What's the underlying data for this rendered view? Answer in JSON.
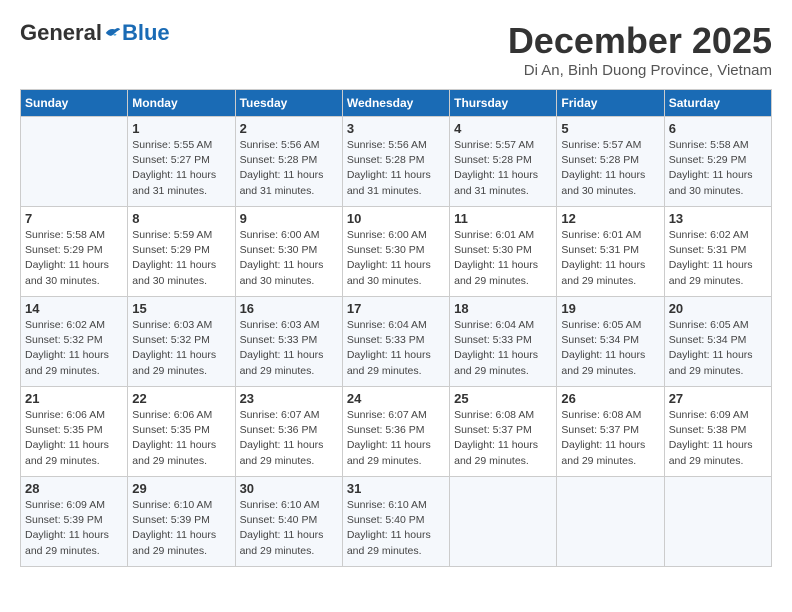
{
  "header": {
    "logo_general": "General",
    "logo_blue": "Blue",
    "month_title": "December 2025",
    "location": "Di An, Binh Duong Province, Vietnam"
  },
  "days_of_week": [
    "Sunday",
    "Monday",
    "Tuesday",
    "Wednesday",
    "Thursday",
    "Friday",
    "Saturday"
  ],
  "weeks": [
    [
      {
        "day": "",
        "sunrise": "",
        "sunset": "",
        "daylight": ""
      },
      {
        "day": "1",
        "sunrise": "5:55 AM",
        "sunset": "5:27 PM",
        "daylight": "11 hours and 31 minutes."
      },
      {
        "day": "2",
        "sunrise": "5:56 AM",
        "sunset": "5:28 PM",
        "daylight": "11 hours and 31 minutes."
      },
      {
        "day": "3",
        "sunrise": "5:56 AM",
        "sunset": "5:28 PM",
        "daylight": "11 hours and 31 minutes."
      },
      {
        "day": "4",
        "sunrise": "5:57 AM",
        "sunset": "5:28 PM",
        "daylight": "11 hours and 31 minutes."
      },
      {
        "day": "5",
        "sunrise": "5:57 AM",
        "sunset": "5:28 PM",
        "daylight": "11 hours and 30 minutes."
      },
      {
        "day": "6",
        "sunrise": "5:58 AM",
        "sunset": "5:29 PM",
        "daylight": "11 hours and 30 minutes."
      }
    ],
    [
      {
        "day": "7",
        "sunrise": "5:58 AM",
        "sunset": "5:29 PM",
        "daylight": "11 hours and 30 minutes."
      },
      {
        "day": "8",
        "sunrise": "5:59 AM",
        "sunset": "5:29 PM",
        "daylight": "11 hours and 30 minutes."
      },
      {
        "day": "9",
        "sunrise": "6:00 AM",
        "sunset": "5:30 PM",
        "daylight": "11 hours and 30 minutes."
      },
      {
        "day": "10",
        "sunrise": "6:00 AM",
        "sunset": "5:30 PM",
        "daylight": "11 hours and 30 minutes."
      },
      {
        "day": "11",
        "sunrise": "6:01 AM",
        "sunset": "5:30 PM",
        "daylight": "11 hours and 29 minutes."
      },
      {
        "day": "12",
        "sunrise": "6:01 AM",
        "sunset": "5:31 PM",
        "daylight": "11 hours and 29 minutes."
      },
      {
        "day": "13",
        "sunrise": "6:02 AM",
        "sunset": "5:31 PM",
        "daylight": "11 hours and 29 minutes."
      }
    ],
    [
      {
        "day": "14",
        "sunrise": "6:02 AM",
        "sunset": "5:32 PM",
        "daylight": "11 hours and 29 minutes."
      },
      {
        "day": "15",
        "sunrise": "6:03 AM",
        "sunset": "5:32 PM",
        "daylight": "11 hours and 29 minutes."
      },
      {
        "day": "16",
        "sunrise": "6:03 AM",
        "sunset": "5:33 PM",
        "daylight": "11 hours and 29 minutes."
      },
      {
        "day": "17",
        "sunrise": "6:04 AM",
        "sunset": "5:33 PM",
        "daylight": "11 hours and 29 minutes."
      },
      {
        "day": "18",
        "sunrise": "6:04 AM",
        "sunset": "5:33 PM",
        "daylight": "11 hours and 29 minutes."
      },
      {
        "day": "19",
        "sunrise": "6:05 AM",
        "sunset": "5:34 PM",
        "daylight": "11 hours and 29 minutes."
      },
      {
        "day": "20",
        "sunrise": "6:05 AM",
        "sunset": "5:34 PM",
        "daylight": "11 hours and 29 minutes."
      }
    ],
    [
      {
        "day": "21",
        "sunrise": "6:06 AM",
        "sunset": "5:35 PM",
        "daylight": "11 hours and 29 minutes."
      },
      {
        "day": "22",
        "sunrise": "6:06 AM",
        "sunset": "5:35 PM",
        "daylight": "11 hours and 29 minutes."
      },
      {
        "day": "23",
        "sunrise": "6:07 AM",
        "sunset": "5:36 PM",
        "daylight": "11 hours and 29 minutes."
      },
      {
        "day": "24",
        "sunrise": "6:07 AM",
        "sunset": "5:36 PM",
        "daylight": "11 hours and 29 minutes."
      },
      {
        "day": "25",
        "sunrise": "6:08 AM",
        "sunset": "5:37 PM",
        "daylight": "11 hours and 29 minutes."
      },
      {
        "day": "26",
        "sunrise": "6:08 AM",
        "sunset": "5:37 PM",
        "daylight": "11 hours and 29 minutes."
      },
      {
        "day": "27",
        "sunrise": "6:09 AM",
        "sunset": "5:38 PM",
        "daylight": "11 hours and 29 minutes."
      }
    ],
    [
      {
        "day": "28",
        "sunrise": "6:09 AM",
        "sunset": "5:39 PM",
        "daylight": "11 hours and 29 minutes."
      },
      {
        "day": "29",
        "sunrise": "6:10 AM",
        "sunset": "5:39 PM",
        "daylight": "11 hours and 29 minutes."
      },
      {
        "day": "30",
        "sunrise": "6:10 AM",
        "sunset": "5:40 PM",
        "daylight": "11 hours and 29 minutes."
      },
      {
        "day": "31",
        "sunrise": "6:10 AM",
        "sunset": "5:40 PM",
        "daylight": "11 hours and 29 minutes."
      },
      {
        "day": "",
        "sunrise": "",
        "sunset": "",
        "daylight": ""
      },
      {
        "day": "",
        "sunrise": "",
        "sunset": "",
        "daylight": ""
      },
      {
        "day": "",
        "sunrise": "",
        "sunset": "",
        "daylight": ""
      }
    ]
  ],
  "labels": {
    "sunrise_prefix": "Sunrise: ",
    "sunset_prefix": "Sunset: ",
    "daylight_prefix": "Daylight: "
  }
}
